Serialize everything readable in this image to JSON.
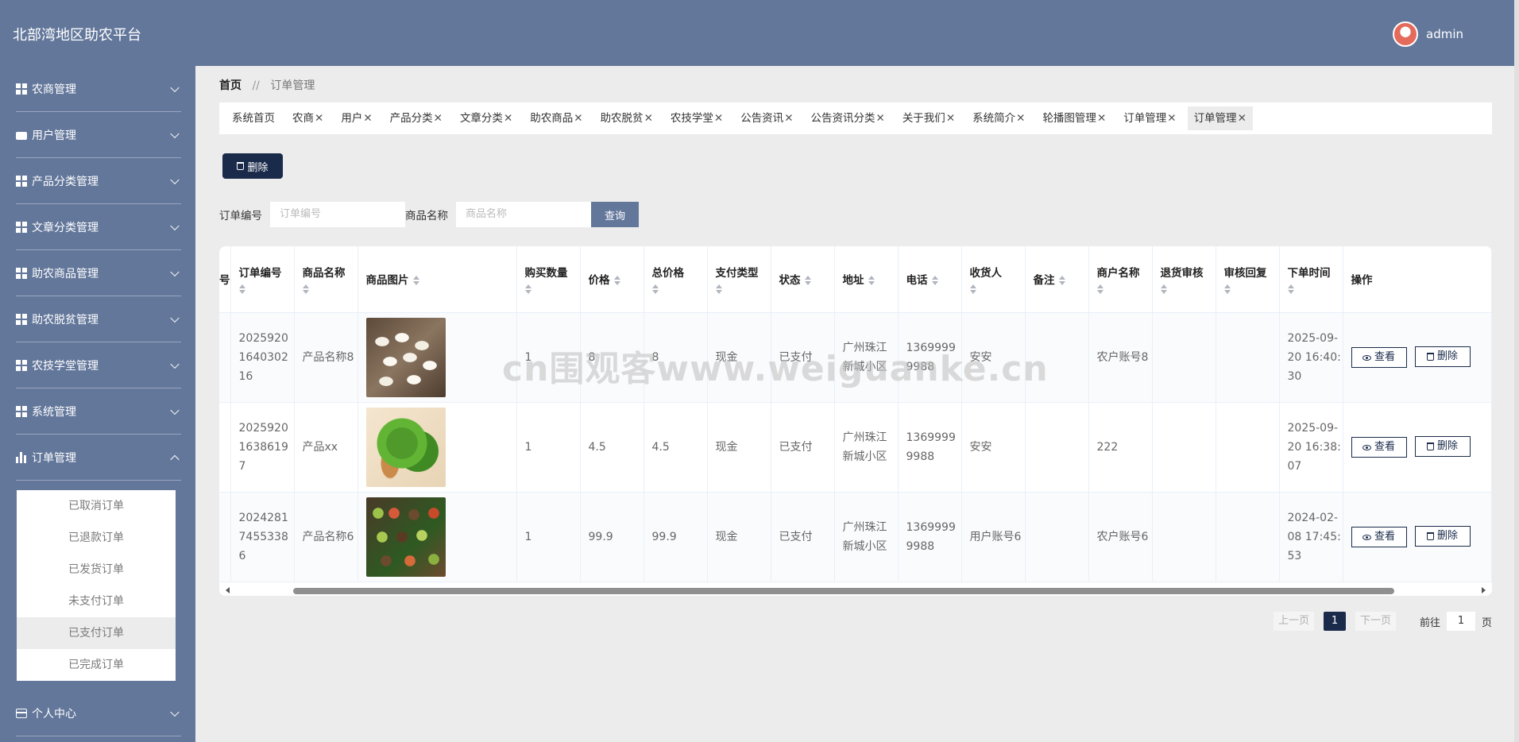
{
  "header": {
    "brand": "北部湾地区助农平台",
    "username": "admin"
  },
  "sidebar": {
    "items": [
      {
        "label": "农商管理",
        "icon": "grid-icon"
      },
      {
        "label": "用户管理",
        "icon": "chat-icon"
      },
      {
        "label": "产品分类管理",
        "icon": "grid-icon"
      },
      {
        "label": "文章分类管理",
        "icon": "table-icon"
      },
      {
        "label": "助农商品管理",
        "icon": "grid-icon"
      },
      {
        "label": "助农脱贫管理",
        "icon": "grid-icon"
      },
      {
        "label": "农技学堂管理",
        "icon": "grid-icon"
      },
      {
        "label": "系统管理",
        "icon": "grid-icon"
      },
      {
        "label": "订单管理",
        "icon": "bar-chart-icon"
      }
    ],
    "submenu": [
      "已取消订单",
      "已退款订单",
      "已发货订单",
      "未支付订单",
      "已支付订单",
      "已完成订单"
    ],
    "submenu_active": "已支付订单",
    "personal": "个人中心"
  },
  "breadcrumb": {
    "home": "首页",
    "sep": "//",
    "current": "订单管理"
  },
  "tabs": [
    {
      "label": "系统首页",
      "x": ""
    },
    {
      "label": "农商",
      "x": "✕"
    },
    {
      "label": "用户",
      "x": "✕"
    },
    {
      "label": "产品分类",
      "x": "✕"
    },
    {
      "label": "文章分类",
      "x": "✕"
    },
    {
      "label": "助农商品",
      "x": "✕"
    },
    {
      "label": "助农脱贫",
      "x": "✕"
    },
    {
      "label": "农技学堂",
      "x": "✕"
    },
    {
      "label": "公告资讯",
      "x": "✕"
    },
    {
      "label": "公告资讯分类",
      "x": "✕"
    },
    {
      "label": "关于我们",
      "x": "✕"
    },
    {
      "label": "系统简介",
      "x": "✕"
    },
    {
      "label": "轮播图管理",
      "x": "✕"
    },
    {
      "label": "订单管理",
      "x": "✕"
    },
    {
      "label": "订单管理",
      "x": "✕"
    }
  ],
  "toolbar": {
    "delete_label": "删除"
  },
  "search": {
    "order_no_label": "订单编号",
    "order_no_placeholder": "订单编号",
    "product_label": "商品名称",
    "product_placeholder": "商品名称",
    "query_label": "查询"
  },
  "table": {
    "partial_first_header": "号",
    "headers": [
      "订单编号",
      "商品名称",
      "商品图片",
      "购买数量",
      "价格",
      "总价格",
      "支付类型",
      "状态",
      "地址",
      "电话",
      "收货人",
      "备注",
      "商户名称",
      "退货审核",
      "审核回复",
      "下单时间",
      "操作"
    ],
    "view_label": "查看",
    "delete_label": "删除",
    "rows": [
      {
        "order_no": "20259201640302 16",
        "product": "产品名称8",
        "image": "white-beans",
        "qty": "1",
        "price": "8",
        "total": "8",
        "pay_type": "现金",
        "status": "已支付",
        "address": "广州珠江新城小区",
        "phone": "13699999988",
        "receiver": "安安",
        "note": "",
        "merchant": "农户账号8",
        "return_audit": "",
        "audit_reply": "",
        "time": "2025-09-20 16:40:30"
      },
      {
        "order_no": "20259201638619 7",
        "product": "产品xx",
        "image": "lettuce",
        "qty": "1",
        "price": "4.5",
        "total": "4.5",
        "pay_type": "现金",
        "status": "已支付",
        "address": "广州珠江新城小区",
        "phone": "13699999988",
        "receiver": "安安",
        "note": "",
        "merchant": "222",
        "return_audit": "",
        "audit_reply": "",
        "time": "2025-09-20 16:38:07"
      },
      {
        "order_no": "20242817455338 6",
        "product": "产品名称6",
        "image": "mixed-vegetables",
        "qty": "1",
        "price": "99.9",
        "total": "99.9",
        "pay_type": "现金",
        "status": "已支付",
        "address": "广州珠江新城小区",
        "phone": "13699999988",
        "receiver": "用户账号6",
        "note": "",
        "merchant": "农户账号6",
        "return_audit": "",
        "audit_reply": "",
        "time": "2024-02-08 17:45:53"
      }
    ]
  },
  "pagination": {
    "prev": "上一页",
    "page": "1",
    "next": "下一页",
    "goto_prefix": "前往",
    "goto_value": "1",
    "goto_suffix": "页"
  },
  "watermark": "cn围观客www.weiguanke.cn",
  "colors": {
    "primary": "#63779b",
    "dark": "#1a2a4a",
    "background": "#ececec"
  }
}
